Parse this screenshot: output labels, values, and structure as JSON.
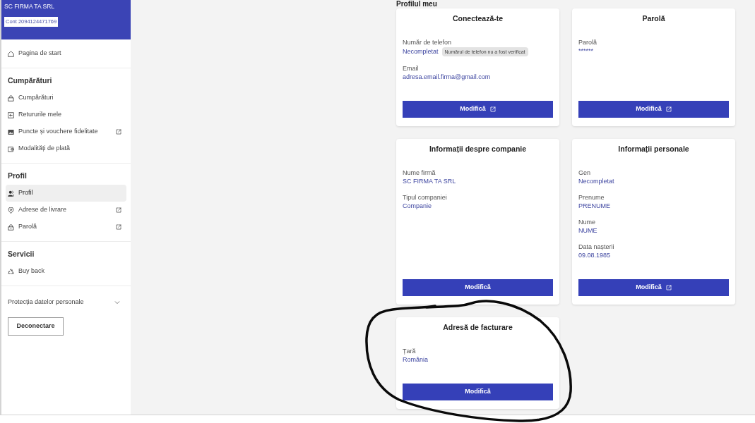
{
  "sidebar": {
    "header": {
      "name": "SC FIRMA TA SRL",
      "account": "Cont 2094124471769"
    },
    "sections": [
      {
        "items": [
          {
            "label": "Pagina de start",
            "selected": false,
            "external_link": false
          }
        ]
      },
      {
        "heading": "Cumpărături",
        "items": [
          {
            "label": "Cumpărături",
            "selected": false,
            "external_link": false
          },
          {
            "label": "Retururile mele",
            "selected": false,
            "external_link": false
          },
          {
            "label": "Puncte și vouchere fidelitate",
            "selected": false,
            "external_link": true
          },
          {
            "label": "Modalități de plată",
            "selected": false,
            "external_link": false
          }
        ]
      },
      {
        "heading": "Profil",
        "items": [
          {
            "label": "Profil",
            "selected": true,
            "external_link": false
          },
          {
            "label": "Adrese de livrare",
            "selected": false,
            "external_link": true
          },
          {
            "label": "Parolă",
            "selected": false,
            "external_link": true
          }
        ]
      },
      {
        "heading": "Servicii",
        "items": [
          {
            "label": "Buy back",
            "selected": false,
            "external_link": false
          }
        ]
      }
    ],
    "privacy": {
      "label": "Protecția datelor personale",
      "expanded": false
    },
    "logout_button": "Deconectare"
  },
  "main": {
    "title": "Profilul meu",
    "cards": [
      {
        "title": "Conectează-te",
        "fields": [
          {
            "label": "Număr de telefon",
            "value": "Necompletat",
            "badge": "Numărul de telefon nu a fost verificat"
          },
          {
            "label": "Email",
            "value": "adresa.email.firma@gmail.com"
          }
        ],
        "button": {
          "label": "Modifică",
          "external_link": true
        }
      },
      {
        "title": "Parolă",
        "fields": [
          {
            "label": "Parolă",
            "value": "******"
          }
        ],
        "button": {
          "label": "Modifică",
          "external_link": true
        }
      },
      {
        "title": "Informații despre companie",
        "fields": [
          {
            "label": "Nume firmă",
            "value": "SC FIRMA TA SRL"
          },
          {
            "label": "Tipul companiei",
            "value": "Companie"
          }
        ],
        "button": {
          "label": "Modifică",
          "external_link": false
        }
      },
      {
        "title": "Informații personale",
        "fields": [
          {
            "label": "Gen",
            "value": "Necompletat"
          },
          {
            "label": "Prenume",
            "value": "PRENUME"
          },
          {
            "label": "Nume",
            "value": "NUME"
          },
          {
            "label": "Data nașterii",
            "value": "09.08.1985"
          }
        ],
        "button": {
          "label": "Modifică",
          "external_link": true
        }
      },
      {
        "title": "Adresă de facturare",
        "fields": [
          {
            "label": "Țară",
            "value": "România"
          }
        ],
        "button": {
          "label": "Modifică",
          "external_link": false
        }
      }
    ]
  }
}
